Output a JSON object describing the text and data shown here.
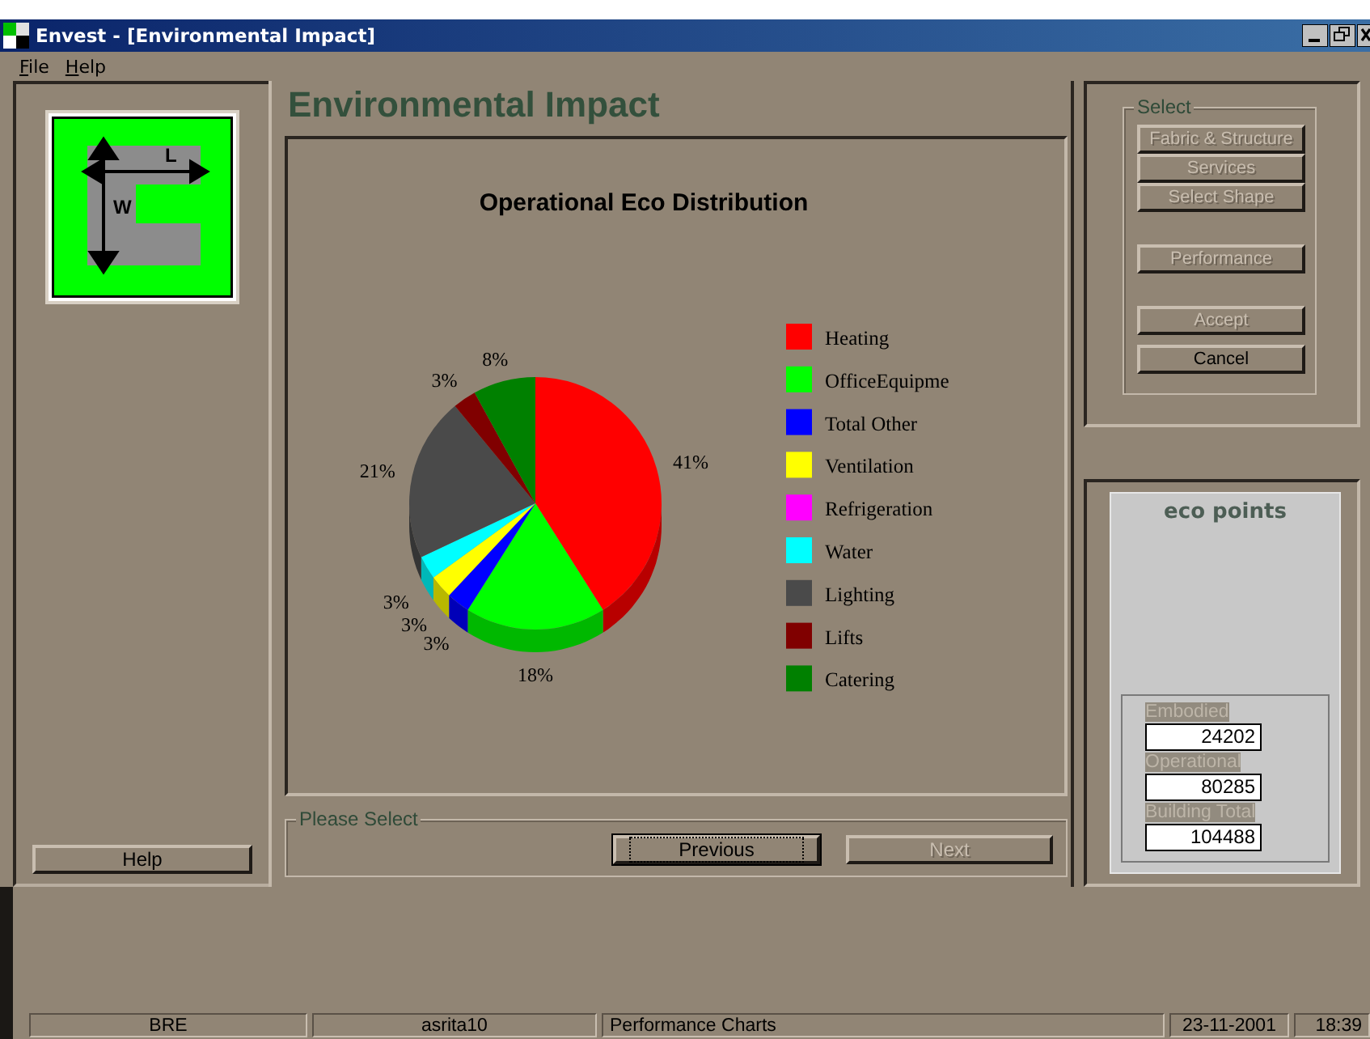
{
  "window": {
    "title": "Envest - [Environmental Impact]"
  },
  "menu": [
    {
      "label": "File"
    },
    {
      "label": "Help"
    }
  ],
  "left_panel": {
    "logo_labels": [
      "L",
      "W"
    ],
    "help_button": "Help"
  },
  "heading": "Environmental Impact",
  "chart": {
    "chart_data": {
      "type": "pie",
      "title": "Operational Eco Distribution",
      "categories": [
        "Heating",
        "OfficeEquipme",
        "Total Other",
        "Ventilation",
        "Refrigeration",
        "Water",
        "Lighting",
        "Lifts",
        "Catering"
      ],
      "series": [
        {
          "values": [
            41,
            18,
            3,
            3,
            0,
            3,
            21,
            3,
            8
          ],
          "colors": [
            "#ff0000",
            "#00ff00",
            "#0000ff",
            "#ffff00",
            "#ff00ff",
            "#00ffff",
            "#4a4a4a",
            "#800000",
            "#008000"
          ]
        }
      ],
      "legend": "right",
      "value_labels": [
        "41%",
        "18%",
        "3%",
        "3%",
        null,
        "3%",
        "21%",
        "3%",
        "8%"
      ]
    }
  },
  "navigation": {
    "group_label": "Please Select",
    "buttons": [
      {
        "label": "Previous",
        "disabled": false,
        "focused": true
      },
      {
        "label": "Next",
        "disabled": true,
        "focused": false
      }
    ]
  },
  "select_panel": {
    "group_label": "Select",
    "button_groups": [
      [
        {
          "label": "Fabric & Structure",
          "disabled": true
        },
        {
          "label": "Services",
          "disabled": true
        },
        {
          "label": "Select Shape",
          "disabled": true
        }
      ],
      [
        {
          "label": "Performance",
          "disabled": true
        }
      ],
      [
        {
          "label": "Accept",
          "disabled": true
        },
        {
          "label": "Cancel",
          "disabled": false
        }
      ]
    ]
  },
  "eco_points": {
    "title": "eco points",
    "fields": [
      {
        "label": "Embodied",
        "value": "24202"
      },
      {
        "label": "Operational",
        "value": "80285"
      },
      {
        "label": "Building Total",
        "value": "104488"
      }
    ]
  },
  "status_bar": [
    "BRE",
    "asrita10",
    "Performance Charts",
    "23-11-2001",
    "18:39"
  ]
}
